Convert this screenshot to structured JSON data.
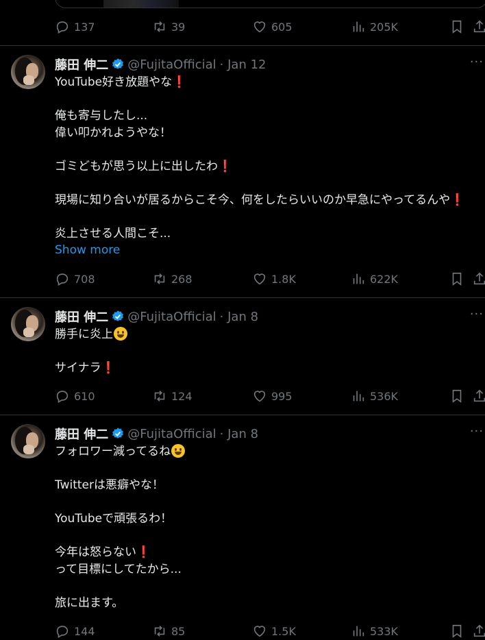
{
  "top_actions": {
    "replies": "137",
    "reposts": "39",
    "likes": "605",
    "views": "205K"
  },
  "tweets": [
    {
      "name": "藤田 伸二",
      "handle": "@FujitaOfficial",
      "date": "· Jan 12",
      "lines": [
        "YouTube好き放題やな",
        "",
        "俺も寄与したし...",
        "偉い叩かれようやな！",
        "",
        "ゴミどもが思う以上に出したわ",
        "",
        "現場に知り合いが居るからこそ今、何をしたらいいのか早急にやってるんや",
        "",
        "炎上させる人間こそ..."
      ],
      "show_more": "Show more",
      "replies": "708",
      "reposts": "268",
      "likes": "1.8K",
      "views": "622K"
    },
    {
      "name": "藤田 伸二",
      "handle": "@FujitaOfficial",
      "date": "· Jan 8",
      "lines": [
        "勝手に炎上",
        "",
        "サイナラ"
      ],
      "replies": "610",
      "reposts": "124",
      "likes": "995",
      "views": "536K"
    },
    {
      "name": "藤田 伸二",
      "handle": "@FujitaOfficial",
      "date": "· Jan 8",
      "lines": [
        "フォロワー減ってるね",
        "",
        "Twitterは悪癖やな！",
        "",
        "YouTubeで頑張るわ！",
        "",
        "今年は怒らない",
        "って目標にしてたから...",
        "",
        "旅に出ます。"
      ],
      "replies": "144",
      "reposts": "85",
      "likes": "1.5K",
      "views": "533K"
    }
  ],
  "colors": {
    "background": "#000000",
    "text": "#e7e9ea",
    "muted": "#71767b",
    "link": "#1d9bf0",
    "verified": "#1d9bf0",
    "exclamation": "#e0245e",
    "divider": "#2f3336"
  },
  "icons": [
    "reply-icon",
    "repost-icon",
    "like-icon",
    "views-icon",
    "bookmark-icon",
    "share-icon",
    "verified-badge-icon",
    "more-icon",
    "red-exclamation-emoji",
    "smiley-emoji"
  ]
}
